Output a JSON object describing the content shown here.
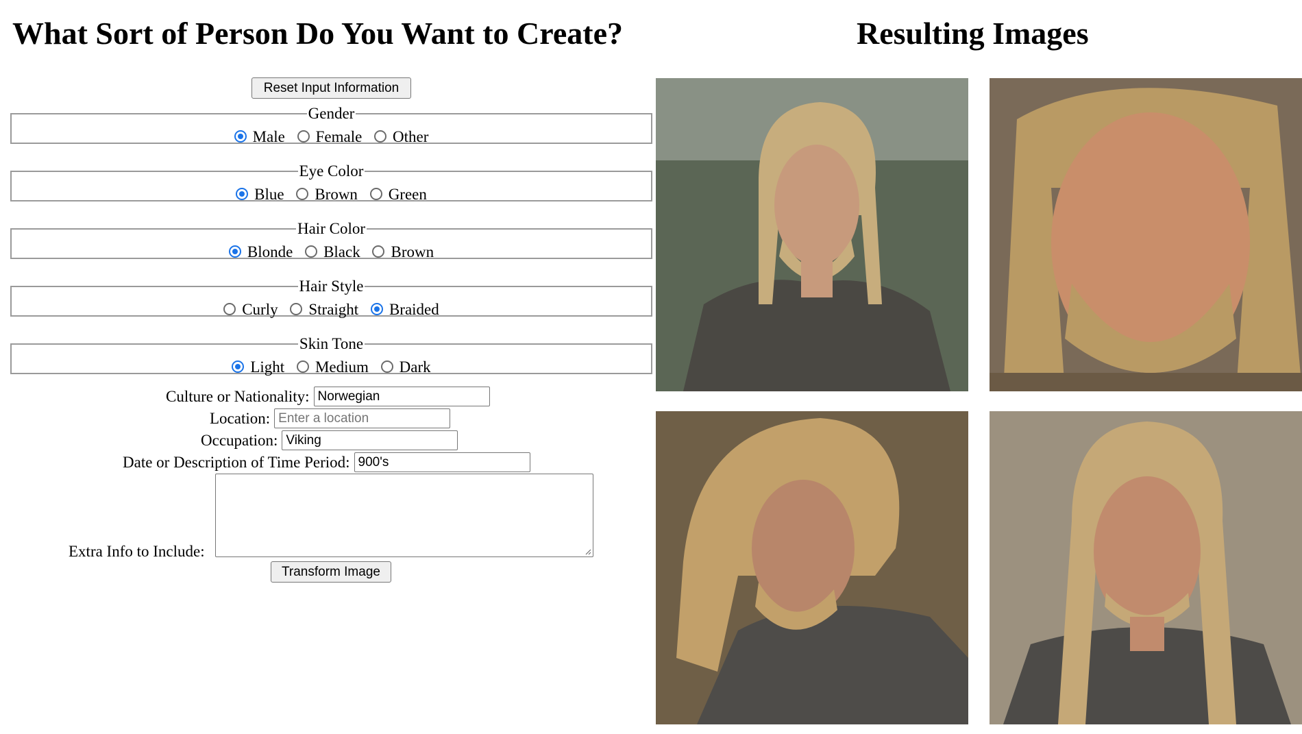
{
  "left_title": "What Sort of Person Do You Want to Create?",
  "right_title": "Resulting Images",
  "reset_button": "Reset Input Information",
  "groups": [
    {
      "legend": "Gender",
      "options": [
        {
          "label": "Male",
          "checked": true
        },
        {
          "label": "Female",
          "checked": false
        },
        {
          "label": "Other",
          "checked": false
        }
      ]
    },
    {
      "legend": "Eye Color",
      "options": [
        {
          "label": "Blue",
          "checked": true
        },
        {
          "label": "Brown",
          "checked": false
        },
        {
          "label": "Green",
          "checked": false
        }
      ]
    },
    {
      "legend": "Hair Color",
      "options": [
        {
          "label": "Blonde",
          "checked": true
        },
        {
          "label": "Black",
          "checked": false
        },
        {
          "label": "Brown",
          "checked": false
        }
      ]
    },
    {
      "legend": "Hair Style",
      "options": [
        {
          "label": "Curly",
          "checked": false
        },
        {
          "label": "Straight",
          "checked": false
        },
        {
          "label": "Braided",
          "checked": true
        }
      ]
    },
    {
      "legend": "Skin Tone",
      "options": [
        {
          "label": "Light",
          "checked": true
        },
        {
          "label": "Medium",
          "checked": false
        },
        {
          "label": "Dark",
          "checked": false
        }
      ]
    }
  ],
  "fields": {
    "culture": {
      "label": "Culture or Nationality:",
      "value": "Norwegian"
    },
    "location": {
      "label": "Location:",
      "value": "",
      "placeholder": "Enter a location"
    },
    "occupation": {
      "label": "Occupation:",
      "value": "Viking"
    },
    "period": {
      "label": "Date or Description of Time Period:",
      "value": "900's"
    },
    "extra": {
      "label": "Extra Info to Include:",
      "value": ""
    }
  },
  "transform_button": "Transform Image",
  "accent_color": "#1a73e8",
  "results": [
    {
      "name": "result-image-1",
      "palette": {
        "bg": "#5b6655",
        "hair": "#c7ad7d",
        "skin": "#c79a7c",
        "clothing": "#4a4843"
      }
    },
    {
      "name": "result-image-2",
      "palette": {
        "bg": "#7a6a58",
        "hair": "#b99a64",
        "skin": "#c98e6a",
        "clothing": "#6b5a45"
      }
    },
    {
      "name": "result-image-3",
      "palette": {
        "bg": "#6f5f47",
        "hair": "#c2a06a",
        "skin": "#b8866a",
        "clothing": "#4e4c49"
      }
    },
    {
      "name": "result-image-4",
      "palette": {
        "bg": "#9c917f",
        "hair": "#c5a877",
        "skin": "#c18b6d",
        "clothing": "#4d4b48"
      }
    }
  ]
}
